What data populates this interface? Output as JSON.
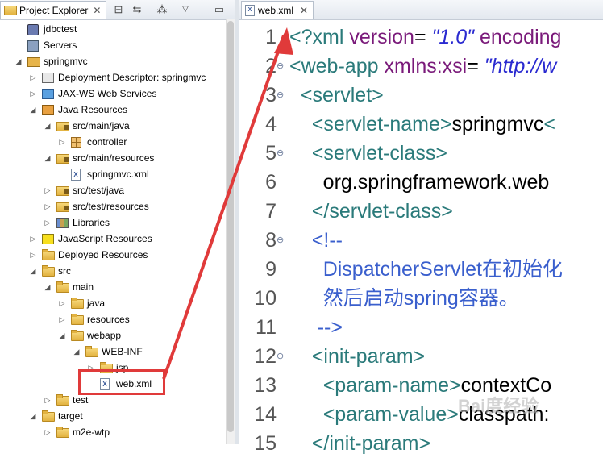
{
  "explorer": {
    "tab_title": "Project Explorer",
    "tab_close": "✕",
    "tools": [
      "⊟",
      "⇆",
      "⁂",
      "▽",
      "▭"
    ],
    "rows": [
      {
        "label": "jdbctest",
        "icon": "db-project-icon",
        "twisty": ""
      },
      {
        "label": "Servers",
        "icon": "servers-icon",
        "twisty": ""
      },
      {
        "label": "springmvc",
        "icon": "project-icon",
        "twisty": "◢"
      },
      {
        "label": "Deployment Descriptor: springmvc",
        "icon": "deployment-descriptor-icon",
        "twisty": "▷"
      },
      {
        "label": "JAX-WS Web Services",
        "icon": "webservice-icon",
        "twisty": "▷"
      },
      {
        "label": "Java Resources",
        "icon": "java-resources-icon",
        "twisty": "◢"
      },
      {
        "label": "src/main/java",
        "icon": "source-folder-icon",
        "twisty": "◢"
      },
      {
        "label": "controller",
        "icon": "package-icon",
        "twisty": "▷"
      },
      {
        "label": "src/main/resources",
        "icon": "source-folder-icon",
        "twisty": "◢"
      },
      {
        "label": "springmvc.xml",
        "icon": "xml-file-icon",
        "twisty": ""
      },
      {
        "label": "src/test/java",
        "icon": "source-folder-icon",
        "twisty": "▷"
      },
      {
        "label": "src/test/resources",
        "icon": "source-folder-icon",
        "twisty": "▷"
      },
      {
        "label": "Libraries",
        "icon": "libraries-icon",
        "twisty": "▷"
      },
      {
        "label": "JavaScript Resources",
        "icon": "javascript-icon",
        "twisty": "▷"
      },
      {
        "label": "Deployed Resources",
        "icon": "folder-icon",
        "twisty": "▷"
      },
      {
        "label": "src",
        "icon": "folder-icon",
        "twisty": "◢"
      },
      {
        "label": "main",
        "icon": "folder-icon",
        "twisty": "◢"
      },
      {
        "label": "java",
        "icon": "folder-icon",
        "twisty": "▷"
      },
      {
        "label": "resources",
        "icon": "folder-icon",
        "twisty": "▷"
      },
      {
        "label": "webapp",
        "icon": "folder-icon",
        "twisty": "◢"
      },
      {
        "label": "WEB-INF",
        "icon": "folder-icon",
        "twisty": "◢"
      },
      {
        "label": "jsp",
        "icon": "folder-icon",
        "twisty": "▷"
      },
      {
        "label": "web.xml",
        "icon": "xml-file-icon",
        "twisty": ""
      },
      {
        "label": "test",
        "icon": "folder-icon",
        "twisty": "▷"
      },
      {
        "label": "target",
        "icon": "folder-icon",
        "twisty": "◢"
      },
      {
        "label": "m2e-wtp",
        "icon": "folder-icon",
        "twisty": "▷"
      }
    ]
  },
  "editor": {
    "tab_title": "web.xml",
    "tab_close": "✕",
    "lines": [
      {
        "n": "1",
        "fold": "",
        "parts": [
          [
            "tag",
            "<?xml "
          ],
          [
            "attr",
            "version"
          ],
          [
            "txt",
            "= "
          ],
          [
            "str",
            "\"1.0\""
          ],
          [
            "txt",
            " "
          ],
          [
            "attr",
            "encoding"
          ]
        ]
      },
      {
        "n": "2",
        "fold": "⊖",
        "parts": [
          [
            "tag",
            "<web-app "
          ],
          [
            "attr",
            "xmlns:xsi"
          ],
          [
            "txt",
            "= "
          ],
          [
            "str",
            "\"http://w"
          ]
        ]
      },
      {
        "n": "3",
        "fold": "⊖",
        "parts": [
          [
            "txt",
            "  "
          ],
          [
            "tag",
            "<servlet>"
          ]
        ]
      },
      {
        "n": "4",
        "fold": "",
        "parts": [
          [
            "txt",
            "    "
          ],
          [
            "tag",
            "<servlet-name>"
          ],
          [
            "txt",
            "springmvc"
          ],
          [
            "tag",
            "<"
          ]
        ]
      },
      {
        "n": "5",
        "fold": "⊖",
        "parts": [
          [
            "txt",
            "    "
          ],
          [
            "tag",
            "<servlet-class>"
          ]
        ]
      },
      {
        "n": "6",
        "fold": "",
        "parts": [
          [
            "txt",
            "      org.springframework.web"
          ]
        ]
      },
      {
        "n": "7",
        "fold": "",
        "parts": [
          [
            "txt",
            "    "
          ],
          [
            "tag",
            "</servlet-class>"
          ]
        ]
      },
      {
        "n": "8",
        "fold": "⊖",
        "parts": [
          [
            "txt",
            "    "
          ],
          [
            "cmt",
            "<!--"
          ]
        ]
      },
      {
        "n": "9",
        "fold": "",
        "parts": [
          [
            "txt",
            "      "
          ],
          [
            "cmt",
            "DispatcherServlet在初始化"
          ]
        ]
      },
      {
        "n": "10",
        "fold": "",
        "parts": [
          [
            "txt",
            "      "
          ],
          [
            "cmt",
            "然后启动spring容器。"
          ]
        ]
      },
      {
        "n": "11",
        "fold": "",
        "parts": [
          [
            "txt",
            "     "
          ],
          [
            "cmt",
            "-->"
          ]
        ]
      },
      {
        "n": "12",
        "fold": "⊖",
        "parts": [
          [
            "txt",
            "    "
          ],
          [
            "tag",
            "<init-param>"
          ]
        ]
      },
      {
        "n": "13",
        "fold": "",
        "parts": [
          [
            "txt",
            "      "
          ],
          [
            "tag",
            "<param-name>"
          ],
          [
            "txt",
            "contextCo"
          ]
        ]
      },
      {
        "n": "14",
        "fold": "",
        "parts": [
          [
            "txt",
            "      "
          ],
          [
            "tag",
            "<param-value>"
          ],
          [
            "txt",
            "classpath:"
          ]
        ]
      },
      {
        "n": "15",
        "fold": "",
        "parts": [
          [
            "txt",
            "    "
          ],
          [
            "tag",
            "</init-param>"
          ]
        ]
      }
    ]
  },
  "watermark": "Bai度经验",
  "colors": {
    "highlight": "#e03a3a"
  }
}
